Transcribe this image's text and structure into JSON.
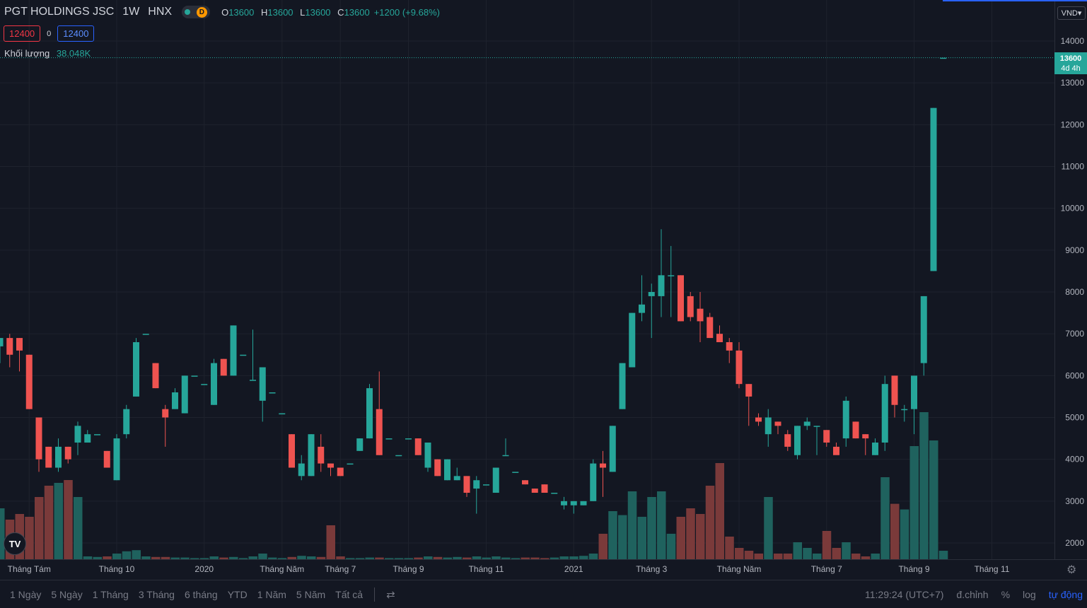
{
  "header": {
    "symbol": "PGT HOLDINGS JSC",
    "interval": "1W",
    "exchange": "HNX",
    "delay_badge": "D",
    "ohlc": [
      {
        "label": "O",
        "value": "13600"
      },
      {
        "label": "H",
        "value": "13600"
      },
      {
        "label": "L",
        "value": "13600"
      },
      {
        "label": "C",
        "value": "13600"
      }
    ],
    "change": "+1200 (+9.68%)",
    "bid": "12400",
    "spread": "0",
    "ask": "12400",
    "volume_label": "Khối lượng",
    "volume_value": "38.048K"
  },
  "price_axis": {
    "currency": "VND",
    "last_price": "13600",
    "countdown": "4d 4h"
  },
  "logo_text": "TV",
  "bottom_bar": {
    "ranges": [
      "1 Ngày",
      "5 Ngày",
      "1 Tháng",
      "3 Tháng",
      "6 tháng",
      "YTD",
      "1 Năm",
      "5 Năm",
      "Tất cả"
    ],
    "clock": "11:29:24 (UTC+7)",
    "adjust": "đ.chỉnh",
    "percent": "%",
    "log": "log",
    "auto": "tự động"
  },
  "colors": {
    "up": "#26a69a",
    "down": "#ef5350",
    "vol_up": "#1f625e",
    "vol_down": "#7a3a3a",
    "accent": "#2962ff",
    "background": "#131722"
  },
  "chart_data": {
    "type": "candlestick",
    "interval": "1W",
    "ylim": [
      1700,
      14500
    ],
    "y_ticks": [
      2000,
      3000,
      4000,
      5000,
      6000,
      7000,
      8000,
      9000,
      10000,
      11000,
      12000,
      13000,
      14000
    ],
    "x_tick_labels": [
      {
        "label": "Tháng Tám",
        "index": 3
      },
      {
        "label": "Tháng 10",
        "index": 12
      },
      {
        "label": "2020",
        "index": 21
      },
      {
        "label": "Tháng Năm",
        "index": 29
      },
      {
        "label": "Tháng 7",
        "index": 35
      },
      {
        "label": "Tháng 9",
        "index": 42
      },
      {
        "label": "Tháng 11",
        "index": 50
      },
      {
        "label": "2021",
        "index": 59
      },
      {
        "label": "Tháng 3",
        "index": 67
      },
      {
        "label": "Tháng Năm",
        "index": 76
      },
      {
        "label": "Tháng 7",
        "index": 85
      },
      {
        "label": "Tháng 9",
        "index": 94
      },
      {
        "label": "Tháng 11",
        "index": 102
      }
    ],
    "candles": [
      {
        "o": 6700,
        "h": 6900,
        "l": 6300,
        "c": 6900,
        "v": 0.9
      },
      {
        "o": 6900,
        "h": 7000,
        "l": 6200,
        "c": 6500,
        "v": 0.7
      },
      {
        "o": 6900,
        "h": 6900,
        "l": 6100,
        "c": 6600,
        "v": 0.8
      },
      {
        "o": 6500,
        "h": 6500,
        "l": 5200,
        "c": 5200,
        "v": 0.75
      },
      {
        "o": 5000,
        "h": 5000,
        "l": 3700,
        "c": 4000,
        "v": 1.1
      },
      {
        "o": 4300,
        "h": 4300,
        "l": 3800,
        "c": 3800,
        "v": 1.3
      },
      {
        "o": 3800,
        "h": 4500,
        "l": 3700,
        "c": 4300,
        "v": 1.35
      },
      {
        "o": 4300,
        "h": 4300,
        "l": 3900,
        "c": 4000,
        "v": 1.4
      },
      {
        "o": 4400,
        "h": 4900,
        "l": 4100,
        "c": 4800,
        "v": 1.1
      },
      {
        "o": 4400,
        "h": 4700,
        "l": 4400,
        "c": 4600,
        "v": 0.05
      },
      {
        "o": 4600,
        "h": 4600,
        "l": 4600,
        "c": 4600,
        "v": 0.04
      },
      {
        "o": 4200,
        "h": 4200,
        "l": 3800,
        "c": 3800,
        "v": 0.05
      },
      {
        "o": 3500,
        "h": 4600,
        "l": 3500,
        "c": 4500,
        "v": 0.1
      },
      {
        "o": 4600,
        "h": 5300,
        "l": 4500,
        "c": 5200,
        "v": 0.14
      },
      {
        "o": 5500,
        "h": 6900,
        "l": 5500,
        "c": 6800,
        "v": 0.16
      },
      {
        "o": 7000,
        "h": 7000,
        "l": 7000,
        "c": 7000,
        "v": 0.05
      },
      {
        "o": 6300,
        "h": 6300,
        "l": 5700,
        "c": 5700,
        "v": 0.04
      },
      {
        "o": 5200,
        "h": 5300,
        "l": 4300,
        "c": 5000,
        "v": 0.04
      },
      {
        "o": 5200,
        "h": 5700,
        "l": 5200,
        "c": 5600,
        "v": 0.03
      },
      {
        "o": 5100,
        "h": 6000,
        "l": 5100,
        "c": 6000,
        "v": 0.03
      },
      {
        "o": 6000,
        "h": 6000,
        "l": 6000,
        "c": 6000,
        "v": 0.02
      },
      {
        "o": 5800,
        "h": 5800,
        "l": 5800,
        "c": 5800,
        "v": 0.02
      },
      {
        "o": 5300,
        "h": 6400,
        "l": 5300,
        "c": 6300,
        "v": 0.05
      },
      {
        "o": 6400,
        "h": 6400,
        "l": 6000,
        "c": 6000,
        "v": 0.03
      },
      {
        "o": 6000,
        "h": 7200,
        "l": 6000,
        "c": 7200,
        "v": 0.04
      },
      {
        "o": 6500,
        "h": 6500,
        "l": 6500,
        "c": 6500,
        "v": 0.02
      },
      {
        "o": 5900,
        "h": 7100,
        "l": 5900,
        "c": 5900,
        "v": 0.05
      },
      {
        "o": 5400,
        "h": 6200,
        "l": 4900,
        "c": 6200,
        "v": 0.1
      },
      {
        "o": 5600,
        "h": 5600,
        "l": 5600,
        "c": 5600,
        "v": 0.03
      },
      {
        "o": 5100,
        "h": 5100,
        "l": 5100,
        "c": 5100,
        "v": 0.02
      },
      {
        "o": 4600,
        "h": 4600,
        "l": 3800,
        "c": 3800,
        "v": 0.04
      },
      {
        "o": 3600,
        "h": 4100,
        "l": 3500,
        "c": 3900,
        "v": 0.06
      },
      {
        "o": 3600,
        "h": 4600,
        "l": 3600,
        "c": 4600,
        "v": 0.05
      },
      {
        "o": 4300,
        "h": 4600,
        "l": 3700,
        "c": 3900,
        "v": 0.04
      },
      {
        "o": 3900,
        "h": 3900,
        "l": 3600,
        "c": 3800,
        "v": 0.6
      },
      {
        "o": 3800,
        "h": 3800,
        "l": 3600,
        "c": 3600,
        "v": 0.05
      },
      {
        "o": 3900,
        "h": 3900,
        "l": 3900,
        "c": 3900,
        "v": 0.02
      },
      {
        "o": 4200,
        "h": 4500,
        "l": 4200,
        "c": 4500,
        "v": 0.02
      },
      {
        "o": 4500,
        "h": 5800,
        "l": 4500,
        "c": 5700,
        "v": 0.03
      },
      {
        "o": 5200,
        "h": 6100,
        "l": 4100,
        "c": 4100,
        "v": 0.03
      },
      {
        "o": 4500,
        "h": 4500,
        "l": 4500,
        "c": 4500,
        "v": 0.02
      },
      {
        "o": 4100,
        "h": 4100,
        "l": 4100,
        "c": 4100,
        "v": 0.02
      },
      {
        "o": 4500,
        "h": 4500,
        "l": 4500,
        "c": 4500,
        "v": 0.02
      },
      {
        "o": 4500,
        "h": 4500,
        "l": 4100,
        "c": 4100,
        "v": 0.03
      },
      {
        "o": 3800,
        "h": 4400,
        "l": 3700,
        "c": 4400,
        "v": 0.05
      },
      {
        "o": 4000,
        "h": 4000,
        "l": 3600,
        "c": 3600,
        "v": 0.04
      },
      {
        "o": 3500,
        "h": 4000,
        "l": 3500,
        "c": 4000,
        "v": 0.03
      },
      {
        "o": 3500,
        "h": 3800,
        "l": 3500,
        "c": 3600,
        "v": 0.04
      },
      {
        "o": 3600,
        "h": 3600,
        "l": 3100,
        "c": 3200,
        "v": 0.03
      },
      {
        "o": 3300,
        "h": 3600,
        "l": 2700,
        "c": 3500,
        "v": 0.05
      },
      {
        "o": 3400,
        "h": 3400,
        "l": 3400,
        "c": 3400,
        "v": 0.03
      },
      {
        "o": 3200,
        "h": 3800,
        "l": 3200,
        "c": 3800,
        "v": 0.05
      },
      {
        "o": 4100,
        "h": 4500,
        "l": 4100,
        "c": 4100,
        "v": 0.03
      },
      {
        "o": 3700,
        "h": 3700,
        "l": 3700,
        "c": 3700,
        "v": 0.02
      },
      {
        "o": 3500,
        "h": 3500,
        "l": 3400,
        "c": 3400,
        "v": 0.03
      },
      {
        "o": 3300,
        "h": 3300,
        "l": 3200,
        "c": 3200,
        "v": 0.03
      },
      {
        "o": 3400,
        "h": 3400,
        "l": 3200,
        "c": 3200,
        "v": 0.02
      },
      {
        "o": 3200,
        "h": 3200,
        "l": 3200,
        "c": 3200,
        "v": 0.03
      },
      {
        "o": 2900,
        "h": 3100,
        "l": 2800,
        "c": 3000,
        "v": 0.05
      },
      {
        "o": 2900,
        "h": 3000,
        "l": 2700,
        "c": 3000,
        "v": 0.05
      },
      {
        "o": 2900,
        "h": 3000,
        "l": 2900,
        "c": 3000,
        "v": 0.06
      },
      {
        "o": 3000,
        "h": 4000,
        "l": 3000,
        "c": 3900,
        "v": 0.1
      },
      {
        "o": 3900,
        "h": 4200,
        "l": 3100,
        "c": 3800,
        "v": 0.45
      },
      {
        "o": 3700,
        "h": 4800,
        "l": 3700,
        "c": 4800,
        "v": 0.85
      },
      {
        "o": 5200,
        "h": 6300,
        "l": 5200,
        "c": 6300,
        "v": 0.78
      },
      {
        "o": 6200,
        "h": 7500,
        "l": 6200,
        "c": 7500,
        "v": 1.2
      },
      {
        "o": 7500,
        "h": 8400,
        "l": 7300,
        "c": 7700,
        "v": 0.75
      },
      {
        "o": 7900,
        "h": 8200,
        "l": 6900,
        "c": 8000,
        "v": 1.1
      },
      {
        "o": 7900,
        "h": 9500,
        "l": 7400,
        "c": 8400,
        "v": 1.2
      },
      {
        "o": 8400,
        "h": 9100,
        "l": 7400,
        "c": 8400,
        "v": 0.45
      },
      {
        "o": 8400,
        "h": 8400,
        "l": 7300,
        "c": 7300,
        "v": 0.75
      },
      {
        "o": 7900,
        "h": 8000,
        "l": 7300,
        "c": 7400,
        "v": 0.9
      },
      {
        "o": 7600,
        "h": 8000,
        "l": 6800,
        "c": 7300,
        "v": 0.8
      },
      {
        "o": 7400,
        "h": 7500,
        "l": 6900,
        "c": 6900,
        "v": 1.3
      },
      {
        "o": 7000,
        "h": 7200,
        "l": 6800,
        "c": 6800,
        "v": 1.7
      },
      {
        "o": 6800,
        "h": 6900,
        "l": 6300,
        "c": 6600,
        "v": 0.4
      },
      {
        "o": 6600,
        "h": 6800,
        "l": 5700,
        "c": 5800,
        "v": 0.2
      },
      {
        "o": 5800,
        "h": 5800,
        "l": 4800,
        "c": 5500,
        "v": 0.15
      },
      {
        "o": 5000,
        "h": 5100,
        "l": 4800,
        "c": 4900,
        "v": 0.1
      },
      {
        "o": 4600,
        "h": 5200,
        "l": 4300,
        "c": 5000,
        "v": 1.1
      },
      {
        "o": 4900,
        "h": 4900,
        "l": 4600,
        "c": 4800,
        "v": 0.1
      },
      {
        "o": 4600,
        "h": 4700,
        "l": 4200,
        "c": 4300,
        "v": 0.1
      },
      {
        "o": 4100,
        "h": 4800,
        "l": 4000,
        "c": 4800,
        "v": 0.3
      },
      {
        "o": 4800,
        "h": 5000,
        "l": 4700,
        "c": 4900,
        "v": 0.2
      },
      {
        "o": 4800,
        "h": 4800,
        "l": 4100,
        "c": 4800,
        "v": 0.1
      },
      {
        "o": 4700,
        "h": 4700,
        "l": 4300,
        "c": 4400,
        "v": 0.5
      },
      {
        "o": 4300,
        "h": 4400,
        "l": 4200,
        "c": 4100,
        "v": 0.2
      },
      {
        "o": 4500,
        "h": 5500,
        "l": 4300,
        "c": 5400,
        "v": 0.3
      },
      {
        "o": 4900,
        "h": 4900,
        "l": 4500,
        "c": 4500,
        "v": 0.1
      },
      {
        "o": 4600,
        "h": 4600,
        "l": 4100,
        "c": 4500,
        "v": 0.05
      },
      {
        "o": 4100,
        "h": 4500,
        "l": 4100,
        "c": 4400,
        "v": 0.1
      },
      {
        "o": 4400,
        "h": 6000,
        "l": 4200,
        "c": 5800,
        "v": 1.45
      },
      {
        "o": 6000,
        "h": 6000,
        "l": 5000,
        "c": 5300,
        "v": 0.98
      },
      {
        "o": 5200,
        "h": 5300,
        "l": 4900,
        "c": 5200,
        "v": 0.88
      },
      {
        "o": 5200,
        "h": 6000,
        "l": 4600,
        "c": 6000,
        "v": 2.0
      },
      {
        "o": 6300,
        "h": 7900,
        "l": 6000,
        "c": 7900,
        "v": 2.6
      },
      {
        "o": 8500,
        "h": 12400,
        "l": 8500,
        "c": 12400,
        "v": 2.1
      },
      {
        "o": 13600,
        "h": 13600,
        "l": 13600,
        "c": 13600,
        "v": 0.15
      }
    ]
  }
}
